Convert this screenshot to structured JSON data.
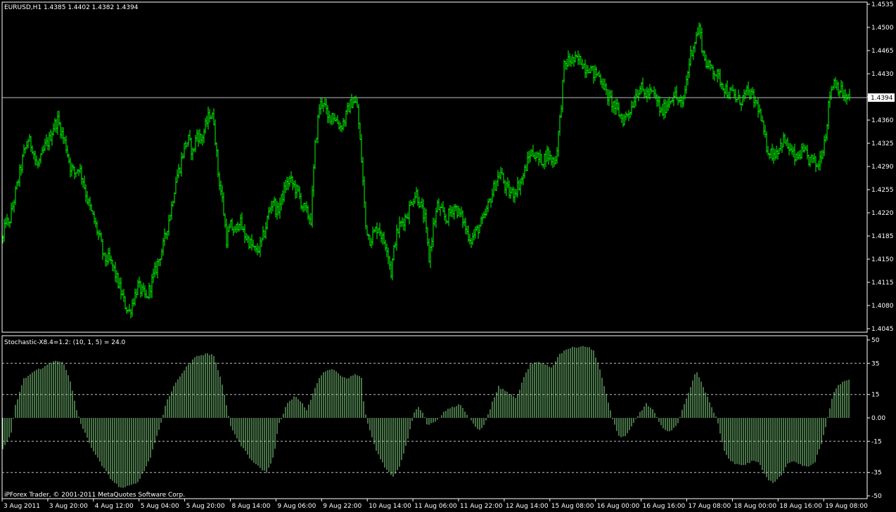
{
  "chart_data": [
    {
      "type": "candlestick",
      "title": "EURUSD,H1  1.4385 1.4402 1.4382 1.4394",
      "current_price_label": "1.4394",
      "ylim": [
        1.4035,
        1.454
      ],
      "y_ticks": [
        "1.4535",
        "1.4500",
        "1.4465",
        "1.4430",
        "1.4395",
        "1.4360",
        "1.4325",
        "1.4290",
        "1.4255",
        "1.4220",
        "1.4185",
        "1.4150",
        "1.4115",
        "1.4080",
        "1.4045"
      ],
      "color": "#00ff00",
      "close_path": [
        [
          0,
          1.418
        ],
        [
          4,
          1.421
        ],
        [
          8,
          1.42
        ],
        [
          12,
          1.422
        ],
        [
          18,
          1.425
        ],
        [
          24,
          1.428
        ],
        [
          30,
          1.431
        ],
        [
          36,
          1.433
        ],
        [
          42,
          1.432
        ],
        [
          48,
          1.429
        ],
        [
          54,
          1.43
        ],
        [
          60,
          1.432
        ],
        [
          66,
          1.433
        ],
        [
          72,
          1.435
        ],
        [
          78,
          1.436
        ],
        [
          84,
          1.434
        ],
        [
          90,
          1.432
        ],
        [
          96,
          1.429
        ],
        [
          102,
          1.428
        ],
        [
          108,
          1.429
        ],
        [
          114,
          1.427
        ],
        [
          120,
          1.424
        ],
        [
          126,
          1.422
        ],
        [
          132,
          1.42
        ],
        [
          138,
          1.418
        ],
        [
          144,
          1.415
        ],
        [
          150,
          1.415
        ],
        [
          156,
          1.414
        ],
        [
          162,
          1.412
        ],
        [
          168,
          1.41
        ],
        [
          174,
          1.408
        ],
        [
          180,
          1.407
        ],
        [
          186,
          1.409
        ],
        [
          192,
          1.411
        ],
        [
          198,
          1.41
        ],
        [
          204,
          1.409
        ],
        [
          210,
          1.411
        ],
        [
          216,
          1.413
        ],
        [
          222,
          1.415
        ],
        [
          228,
          1.417
        ],
        [
          234,
          1.42
        ],
        [
          240,
          1.423
        ],
        [
          246,
          1.427
        ],
        [
          252,
          1.429
        ],
        [
          258,
          1.432
        ],
        [
          264,
          1.433
        ],
        [
          270,
          1.431
        ],
        [
          276,
          1.434
        ],
        [
          282,
          1.433
        ],
        [
          288,
          1.435
        ],
        [
          294,
          1.437
        ],
        [
          300,
          1.436
        ],
        [
          306,
          1.428
        ],
        [
          312,
          1.424
        ],
        [
          318,
          1.418
        ],
        [
          324,
          1.42
        ],
        [
          330,
          1.419
        ],
        [
          336,
          1.421
        ],
        [
          342,
          1.419
        ],
        [
          348,
          1.418
        ],
        [
          354,
          1.417
        ],
        [
          360,
          1.416
        ],
        [
          366,
          1.417
        ],
        [
          372,
          1.419
        ],
        [
          378,
          1.422
        ],
        [
          384,
          1.424
        ],
        [
          390,
          1.422
        ],
        [
          396,
          1.424
        ],
        [
          402,
          1.426
        ],
        [
          408,
          1.427
        ],
        [
          414,
          1.426
        ],
        [
          420,
          1.425
        ],
        [
          426,
          1.423
        ],
        [
          432,
          1.422
        ],
        [
          438,
          1.421
        ],
        [
          444,
          1.432
        ],
        [
          450,
          1.438
        ],
        [
          456,
          1.439
        ],
        [
          462,
          1.436
        ],
        [
          468,
          1.437
        ],
        [
          474,
          1.436
        ],
        [
          480,
          1.435
        ],
        [
          486,
          1.436
        ],
        [
          492,
          1.438
        ],
        [
          498,
          1.439
        ],
        [
          504,
          1.438
        ],
        [
          510,
          1.43
        ],
        [
          516,
          1.42
        ],
        [
          522,
          1.418
        ],
        [
          528,
          1.419
        ],
        [
          534,
          1.42
        ],
        [
          540,
          1.418
        ],
        [
          546,
          1.417
        ],
        [
          552,
          1.413
        ],
        [
          558,
          1.418
        ],
        [
          564,
          1.42
        ],
        [
          570,
          1.421
        ],
        [
          576,
          1.422
        ],
        [
          582,
          1.424
        ],
        [
          588,
          1.425
        ],
        [
          594,
          1.423
        ],
        [
          600,
          1.421
        ],
        [
          606,
          1.415
        ],
        [
          612,
          1.42
        ],
        [
          618,
          1.423
        ],
        [
          624,
          1.422
        ],
        [
          630,
          1.421
        ],
        [
          636,
          1.422
        ],
        [
          642,
          1.423
        ],
        [
          648,
          1.422
        ],
        [
          654,
          1.421
        ],
        [
          660,
          1.419
        ],
        [
          666,
          1.418
        ],
        [
          672,
          1.419
        ],
        [
          678,
          1.42
        ],
        [
          684,
          1.421
        ],
        [
          690,
          1.423
        ],
        [
          696,
          1.425
        ],
        [
          702,
          1.427
        ],
        [
          708,
          1.428
        ],
        [
          714,
          1.426
        ],
        [
          720,
          1.425
        ],
        [
          726,
          1.425
        ],
        [
          732,
          1.426
        ],
        [
          738,
          1.427
        ],
        [
          744,
          1.429
        ],
        [
          750,
          1.431
        ],
        [
          756,
          1.431
        ],
        [
          762,
          1.43
        ],
        [
          768,
          1.43
        ],
        [
          774,
          1.431
        ],
        [
          780,
          1.43
        ],
        [
          786,
          1.43
        ],
        [
          792,
          1.436
        ],
        [
          798,
          1.444
        ],
        [
          804,
          1.445
        ],
        [
          810,
          1.445
        ],
        [
          816,
          1.445
        ],
        [
          822,
          1.445
        ],
        [
          828,
          1.444
        ],
        [
          834,
          1.444
        ],
        [
          840,
          1.443
        ],
        [
          846,
          1.443
        ],
        [
          852,
          1.442
        ],
        [
          858,
          1.44
        ],
        [
          864,
          1.439
        ],
        [
          870,
          1.438
        ],
        [
          876,
          1.437
        ],
        [
          882,
          1.436
        ],
        [
          888,
          1.437
        ],
        [
          894,
          1.438
        ],
        [
          900,
          1.44
        ],
        [
          906,
          1.441
        ],
        [
          912,
          1.44
        ],
        [
          918,
          1.44
        ],
        [
          924,
          1.44
        ],
        [
          930,
          1.439
        ],
        [
          936,
          1.437
        ],
        [
          942,
          1.438
        ],
        [
          948,
          1.439
        ],
        [
          954,
          1.44
        ],
        [
          960,
          1.439
        ],
        [
          966,
          1.438
        ],
        [
          972,
          1.442
        ],
        [
          978,
          1.446
        ],
        [
          984,
          1.448
        ],
        [
          990,
          1.45
        ],
        [
          996,
          1.446
        ],
        [
          1002,
          1.444
        ],
        [
          1008,
          1.444
        ],
        [
          1014,
          1.443
        ],
        [
          1020,
          1.442
        ],
        [
          1026,
          1.441
        ],
        [
          1032,
          1.44
        ],
        [
          1038,
          1.44
        ],
        [
          1044,
          1.439
        ],
        [
          1050,
          1.439
        ],
        [
          1056,
          1.44
        ],
        [
          1062,
          1.44
        ],
        [
          1068,
          1.439
        ],
        [
          1074,
          1.438
        ],
        [
          1080,
          1.435
        ],
        [
          1086,
          1.432
        ],
        [
          1092,
          1.431
        ],
        [
          1098,
          1.431
        ],
        [
          1104,
          1.432
        ],
        [
          1110,
          1.433
        ],
        [
          1116,
          1.432
        ],
        [
          1122,
          1.431
        ],
        [
          1128,
          1.43
        ],
        [
          1134,
          1.431
        ],
        [
          1140,
          1.431
        ],
        [
          1146,
          1.43
        ],
        [
          1152,
          1.43
        ],
        [
          1158,
          1.429
        ],
        [
          1164,
          1.431
        ],
        [
          1170,
          1.434
        ],
        [
          1176,
          1.44
        ],
        [
          1182,
          1.442
        ],
        [
          1188,
          1.441
        ],
        [
          1194,
          1.44
        ],
        [
          1200,
          1.439
        ],
        [
          1204,
          1.4394
        ]
      ],
      "x_tick_labels": [
        "3 Aug 2011",
        "3 Aug 20:00",
        "4 Aug 12:00",
        "5 Aug 04:00",
        "5 Aug 20:00",
        "8 Aug 14:00",
        "9 Aug 06:00",
        "9 Aug 22:00",
        "10 Aug 14:00",
        "11 Aug 06:00",
        "11 Aug 22:00",
        "12 Aug 14:00",
        "15 Aug 08:00",
        "16 Aug 00:00",
        "16 Aug 16:00",
        "17 Aug 08:00",
        "18 Aug 00:00",
        "18 Aug 16:00",
        "19 Aug 08:00"
      ]
    },
    {
      "type": "bar",
      "title": "Stochastic-X8.4=1.2: (10, 1, 5) = 24.0",
      "ylim": [
        -50,
        50
      ],
      "y_ticks": [
        "50",
        "35",
        "15",
        "0.00",
        "-15",
        "-35",
        "-50"
      ],
      "color": "#8ee68e",
      "osc_path": [
        [
          0,
          -20
        ],
        [
          12,
          -10
        ],
        [
          18,
          8
        ],
        [
          30,
          25
        ],
        [
          45,
          30
        ],
        [
          60,
          33
        ],
        [
          75,
          37
        ],
        [
          85,
          36
        ],
        [
          95,
          25
        ],
        [
          105,
          5
        ],
        [
          112,
          -5
        ],
        [
          125,
          -18
        ],
        [
          140,
          -30
        ],
        [
          155,
          -40
        ],
        [
          168,
          -45
        ],
        [
          178,
          -44
        ],
        [
          190,
          -42
        ],
        [
          200,
          -35
        ],
        [
          210,
          -25
        ],
        [
          220,
          -10
        ],
        [
          226,
          -2
        ],
        [
          232,
          10
        ],
        [
          245,
          22
        ],
        [
          260,
          32
        ],
        [
          275,
          40
        ],
        [
          290,
          41
        ],
        [
          300,
          40
        ],
        [
          310,
          25
        ],
        [
          318,
          8
        ],
        [
          324,
          -5
        ],
        [
          335,
          -15
        ],
        [
          350,
          -25
        ],
        [
          365,
          -32
        ],
        [
          375,
          -35
        ],
        [
          385,
          -25
        ],
        [
          392,
          -5
        ],
        [
          398,
          2
        ],
        [
          405,
          10
        ],
        [
          415,
          14
        ],
        [
          425,
          10
        ],
        [
          432,
          5
        ],
        [
          440,
          14
        ],
        [
          448,
          24
        ],
        [
          460,
          31
        ],
        [
          470,
          31
        ],
        [
          480,
          27
        ],
        [
          490,
          25
        ],
        [
          500,
          28
        ],
        [
          510,
          26
        ],
        [
          514,
          5
        ],
        [
          520,
          -5
        ],
        [
          530,
          -20
        ],
        [
          545,
          -33
        ],
        [
          555,
          -38
        ],
        [
          565,
          -30
        ],
        [
          575,
          -15
        ],
        [
          580,
          -5
        ],
        [
          584,
          2
        ],
        [
          590,
          8
        ],
        [
          598,
          3
        ],
        [
          604,
          -5
        ],
        [
          612,
          -3
        ],
        [
          620,
          0
        ],
        [
          630,
          5
        ],
        [
          640,
          7
        ],
        [
          650,
          9
        ],
        [
          656,
          5
        ],
        [
          662,
          0
        ],
        [
          668,
          -3
        ],
        [
          676,
          -8
        ],
        [
          684,
          -5
        ],
        [
          690,
          2
        ],
        [
          696,
          10
        ],
        [
          705,
          20
        ],
        [
          715,
          17
        ],
        [
          722,
          15
        ],
        [
          730,
          12
        ],
        [
          740,
          25
        ],
        [
          750,
          34
        ],
        [
          760,
          36
        ],
        [
          770,
          35
        ],
        [
          780,
          32
        ],
        [
          790,
          40
        ],
        [
          800,
          44
        ],
        [
          810,
          45
        ],
        [
          820,
          46
        ],
        [
          830,
          46
        ],
        [
          840,
          43
        ],
        [
          848,
          33
        ],
        [
          855,
          20
        ],
        [
          862,
          8
        ],
        [
          868,
          -2
        ],
        [
          876,
          -12
        ],
        [
          886,
          -12
        ],
        [
          895,
          -5
        ],
        [
          905,
          3
        ],
        [
          915,
          9
        ],
        [
          925,
          5
        ],
        [
          932,
          -2
        ],
        [
          940,
          -8
        ],
        [
          950,
          -8
        ],
        [
          960,
          -4
        ],
        [
          968,
          8
        ],
        [
          978,
          20
        ],
        [
          986,
          30
        ],
        [
          992,
          25
        ],
        [
          1000,
          15
        ],
        [
          1010,
          5
        ],
        [
          1016,
          -2
        ],
        [
          1025,
          -20
        ],
        [
          1035,
          -28
        ],
        [
          1045,
          -30
        ],
        [
          1055,
          -30
        ],
        [
          1065,
          -28
        ],
        [
          1075,
          -28
        ],
        [
          1085,
          -38
        ],
        [
          1095,
          -42
        ],
        [
          1105,
          -38
        ],
        [
          1115,
          -30
        ],
        [
          1125,
          -28
        ],
        [
          1135,
          -30
        ],
        [
          1145,
          -32
        ],
        [
          1155,
          -28
        ],
        [
          1165,
          -15
        ],
        [
          1172,
          -2
        ],
        [
          1180,
          15
        ],
        [
          1190,
          22
        ],
        [
          1200,
          24
        ],
        [
          1204,
          24
        ]
      ],
      "copyright": "iPForex Trader, © 2001-2011 MetaQuotes Software Corp."
    }
  ]
}
